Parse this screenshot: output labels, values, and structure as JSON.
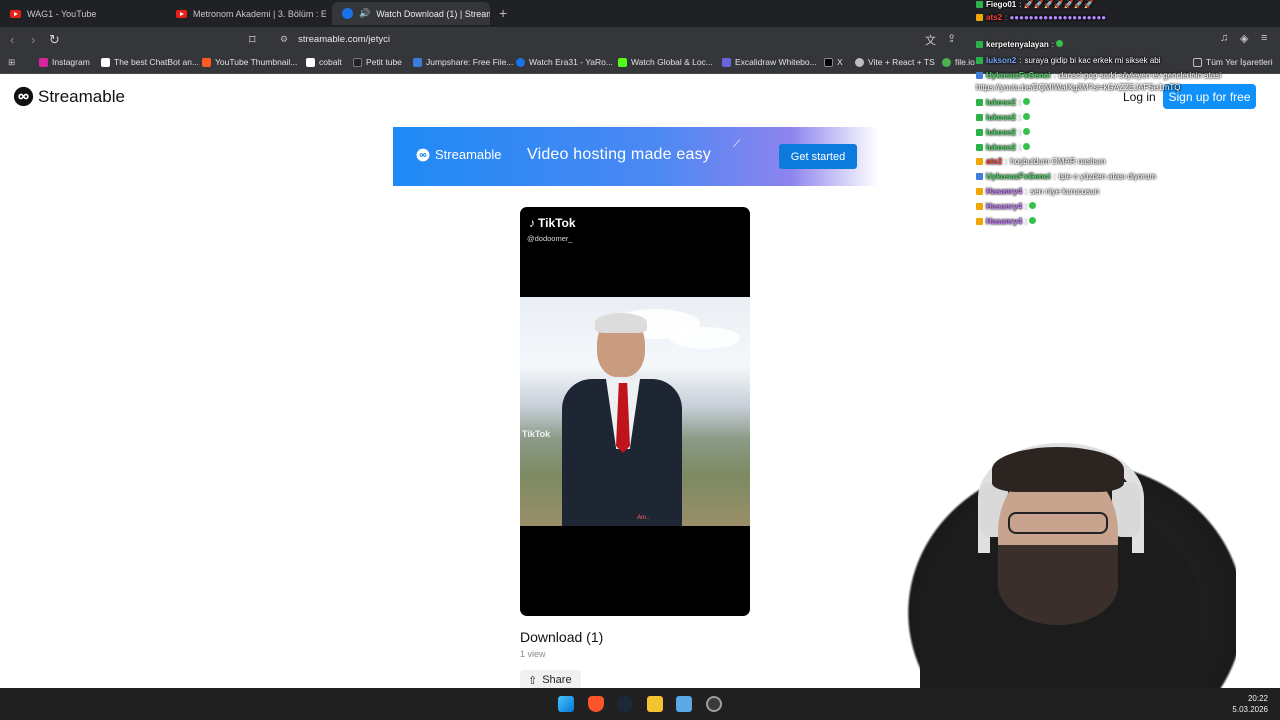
{
  "tabs": [
    {
      "title": "WAG1 - YouTube",
      "icon": "youtube-icon"
    },
    {
      "title": "Metronom Akademi | 3. Bölüm : Emir...",
      "icon": "youtube-icon"
    },
    {
      "title": "Watch Download (1) | Stream...",
      "icon": "streamable-icon",
      "active": true
    }
  ],
  "new_tab_label": "+",
  "address_bar": {
    "url": "streamable.com/jetyci"
  },
  "bookmarks": [
    {
      "label": "Instagram",
      "color": "#d6249f"
    },
    {
      "label": "The best ChatBot an...",
      "color": "#ffffff"
    },
    {
      "label": "YouTube Thumbnail...",
      "color": "#ff5a1f"
    },
    {
      "label": "cobalt",
      "color": "#ffffff"
    },
    {
      "label": "Petit tube",
      "color": "#222222"
    },
    {
      "label": "Jumpshare: Free File...",
      "color": "#3b7ddd"
    },
    {
      "label": "Watch Era31 - YaRo...",
      "color": "#1a73e8"
    },
    {
      "label": "Watch Global & Loc...",
      "color": "#53fc18"
    },
    {
      "label": "Excalidraw Whitebo...",
      "color": "#6965db"
    },
    {
      "label": "X",
      "color": "#000000"
    },
    {
      "label": "Vite + React + TS",
      "color": "#bdbdbd"
    },
    {
      "label": "file.io",
      "color": "#4caf50"
    },
    {
      "label": "Tüm Yer İşaretleri",
      "color": "#bdbdbd"
    }
  ],
  "site": {
    "logo_text": "Streamable",
    "login": "Log in",
    "signup": "Sign up for free"
  },
  "banner": {
    "logo_text": "Streamable",
    "headline": "Video hosting made easy",
    "cta": "Get started"
  },
  "video": {
    "platform_label": "TikTok",
    "handle": "@dodoomer_",
    "watermark": "TikTok",
    "signature": "Anı..",
    "title": "Download (1)",
    "views": "1 view",
    "share_label": "Share"
  },
  "chat": [
    {
      "nick": "Fiego01",
      "text": "",
      "nick_color": "#ffffff",
      "badge": "g"
    },
    {
      "nick": "ats2",
      "text": "",
      "nick_color": "#ff4040",
      "badge": "y"
    },
    {
      "nick": "kerpetenyalayan",
      "text": "",
      "nick_color": "#ffffff",
      "badge": "g"
    },
    {
      "nick": "lukson2",
      "text": "suraya gidip bi kac erkek mi siksek abi",
      "nick_color": "#7aa8ff",
      "badge": "g"
    },
    {
      "nick": "UykusuzFxGenci",
      "text": "dansci pop sarki söyleyen ev genclerinin atasi",
      "nick_color": "#4cd964",
      "badge": "b"
    },
    {
      "nick": "",
      "text": "https://youtu.be/DQMIWaIXg3M?si=kGAZZEJAFSe1mTQ",
      "nick_color": "#ffffff",
      "badge": "none"
    },
    {
      "nick": "lukose2",
      "text": "",
      "nick_color": "#4cd964",
      "badge": "g"
    },
    {
      "nick": "lukose2",
      "text": "",
      "nick_color": "#4cd964",
      "badge": "g"
    },
    {
      "nick": "lukose2",
      "text": "",
      "nick_color": "#4cd964",
      "badge": "g"
    },
    {
      "nick": "lukose2",
      "text": "",
      "nick_color": "#4cd964",
      "badge": "g"
    },
    {
      "nick": "ats2",
      "text": "hoşbuldum OMAR naslısın",
      "nick_color": "#ff4040",
      "badge": "y"
    },
    {
      "nick": "UykusuzFxGenci",
      "text": "işte o yüzden atası diyorum",
      "nick_color": "#4cd964",
      "badge": "b"
    },
    {
      "nick": "Hasanry4",
      "text": "sen niye kurucusun",
      "nick_color": "#c77dff",
      "badge": "y"
    },
    {
      "nick": "Hasanry4",
      "text": "",
      "nick_color": "#c77dff",
      "badge": "y"
    },
    {
      "nick": "Hasanry4",
      "text": "",
      "nick_color": "#c77dff",
      "badge": "y"
    }
  ],
  "taskbar": {
    "time": "20:22",
    "date": "5.03.2026",
    "icons": [
      "windows-start-icon",
      "brave-browser-icon",
      "steam-icon",
      "file-explorer-icon",
      "photos-icon",
      "chrome-icon"
    ]
  }
}
